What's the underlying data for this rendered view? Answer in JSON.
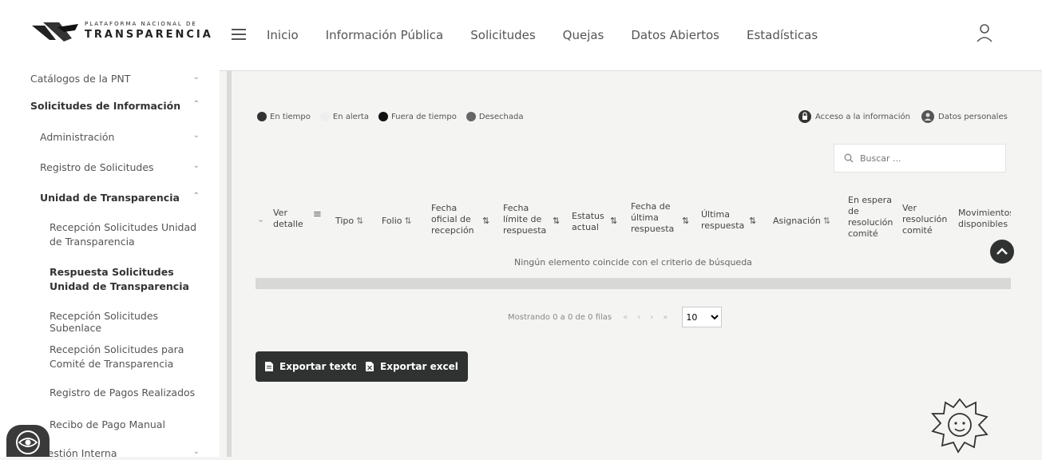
{
  "header": {
    "logo_top": "PLATAFORMA NACIONAL DE",
    "logo_main": "TRANSPARENCIA",
    "nav": [
      "Inicio",
      "Información Pública",
      "Solicitudes",
      "Quejas",
      "Datos Abiertos",
      "Estadísticas"
    ],
    "menu_icon": "hamburger-icon",
    "user_icon": "user-icon"
  },
  "sidebar": {
    "items": [
      {
        "label": "Catálogos de la PNT"
      },
      {
        "label": "Solicitudes de Información"
      },
      {
        "label": "Administración"
      },
      {
        "label": "Registro de Solicitudes"
      },
      {
        "label": "Unidad de Transparencia"
      },
      {
        "label": "Recepción Solicitudes Unidad de Transparencia"
      },
      {
        "label": "Respuesta Solicitudes Unidad de Transparencia"
      },
      {
        "label": "Recepción Solicitudes Subenlace"
      },
      {
        "label": "Recepción Solicitudes para Comité de Transparencia"
      },
      {
        "label": "Registro de Pagos Realizados"
      },
      {
        "label": "Recibo de Pago Manual"
      },
      {
        "label": "Gestión Interna"
      }
    ]
  },
  "legend": {
    "items": [
      {
        "label": "En tiempo",
        "color": "#333333"
      },
      {
        "label": "En alerta",
        "color": "#eeeeee"
      },
      {
        "label": "Fuera de tiempo",
        "color": "#111111"
      },
      {
        "label": "Desechada",
        "color": "#666666"
      }
    ],
    "types": [
      {
        "label": "Acceso a la información",
        "icon": "lock-icon"
      },
      {
        "label": "Datos personales",
        "icon": "person-icon"
      }
    ]
  },
  "search": {
    "placeholder": "Buscar ..."
  },
  "table": {
    "columns": [
      "Ver detalle",
      "Tipo",
      "Folio",
      "Fecha oficial de recepción",
      "Fecha límite de respuesta",
      "Estatus actual",
      "Fecha de última respuesta",
      "Última respuesta",
      "Asignación",
      "En espera de resolución comité",
      "Ver resolución comité",
      "Movimientos disponibles"
    ],
    "empty_message": "Ningún elemento coincide con el criterio de búsqueda"
  },
  "pager": {
    "summary": "Mostrando 0 a 0 de 0 filas",
    "page_size": "10"
  },
  "buttons": {
    "export_text": "Exportar texto",
    "export_excel": "Exportar excel"
  }
}
